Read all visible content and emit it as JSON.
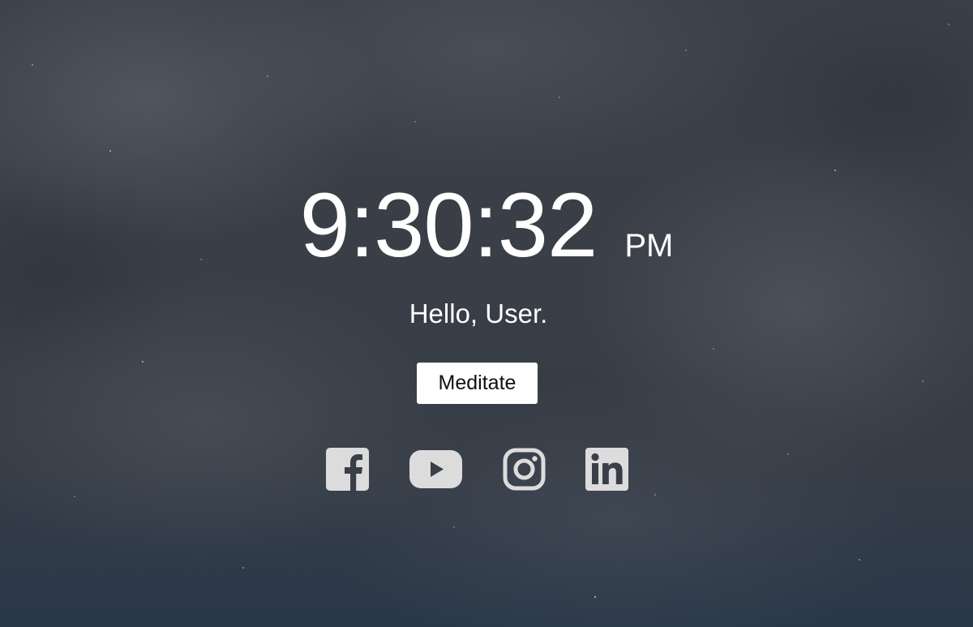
{
  "clock": {
    "time": "9:30:32",
    "ampm": "PM"
  },
  "greeting": "Hello, User.",
  "meditate_button": "Meditate",
  "social_links": [
    {
      "icon": "facebook-icon"
    },
    {
      "icon": "youtube-icon"
    },
    {
      "icon": "instagram-icon"
    },
    {
      "icon": "linkedin-icon"
    }
  ],
  "colors": {
    "icon": "#dcdcdc",
    "text": "#ffffff",
    "button_bg": "#ffffff",
    "button_text": "#111111"
  }
}
